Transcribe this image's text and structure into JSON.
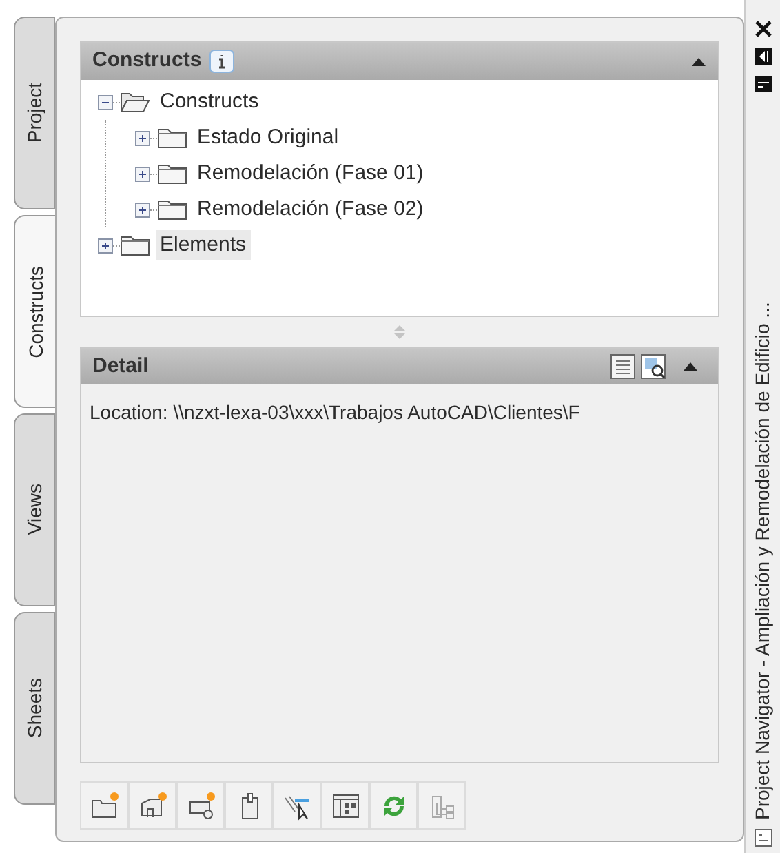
{
  "side_tabs": [
    {
      "label": "Project",
      "selected": false
    },
    {
      "label": "Constructs",
      "selected": true
    },
    {
      "label": "Views",
      "selected": false
    },
    {
      "label": "Sheets",
      "selected": false
    }
  ],
  "constructs_panel": {
    "title": "Constructs",
    "tree": [
      {
        "label": "Constructs",
        "expanded": true,
        "selected": false,
        "children": [
          {
            "label": "Estado Original",
            "expanded": false,
            "selected": false
          },
          {
            "label": "Remodelación (Fase 01)",
            "expanded": false,
            "selected": false
          },
          {
            "label": "Remodelación (Fase 02)",
            "expanded": false,
            "selected": false
          }
        ]
      },
      {
        "label": "Elements",
        "expanded": false,
        "selected": true
      }
    ]
  },
  "detail_panel": {
    "title": "Detail",
    "location": "Location: \\\\nzxt-lexa-03\\xxx\\Trabajos AutoCAD\\Clientes\\F"
  },
  "palette_title": "Project Navigator - Ampliación y Remodelación de Edificio ..."
}
